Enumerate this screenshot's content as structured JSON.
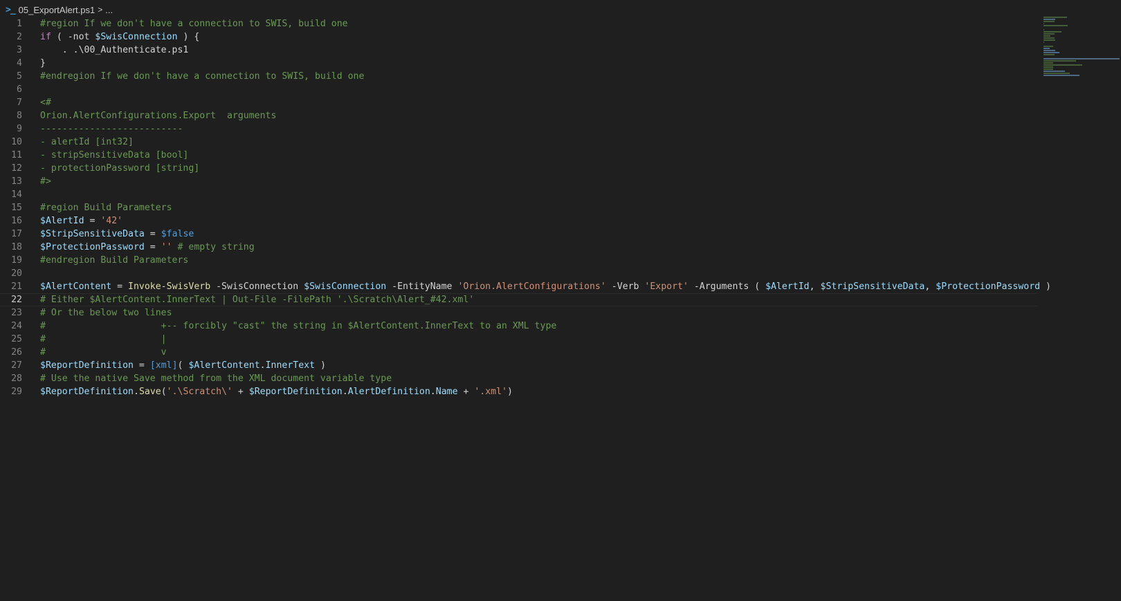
{
  "breadcrumb": {
    "icon": "powershell-icon",
    "file": "05_ExportAlert.ps1",
    "separator": ">",
    "more": "..."
  },
  "colors": {
    "background": "#1f1f1f",
    "comment": "#6a9955",
    "keyword": "#c586c0",
    "variable": "#9cdcfe",
    "string": "#ce9178",
    "function": "#dcdcaa",
    "boolean": "#569cd6",
    "plain": "#d4d4d4",
    "line_number": "#858585"
  },
  "editor": {
    "current_line": 22,
    "lines": [
      {
        "n": "1",
        "tokens": [
          [
            "com",
            "#region If we don't have a connection to SWIS, build one"
          ]
        ]
      },
      {
        "n": "2",
        "tokens": [
          [
            "kw",
            "if"
          ],
          [
            "plain",
            " ( -not "
          ],
          [
            "var",
            "$SwisConnection"
          ],
          [
            "plain",
            " ) {"
          ]
        ]
      },
      {
        "n": "3",
        "tokens": [
          [
            "plain",
            "    . .\\00_Authenticate.ps1"
          ]
        ]
      },
      {
        "n": "4",
        "tokens": [
          [
            "plain",
            "}"
          ]
        ]
      },
      {
        "n": "5",
        "tokens": [
          [
            "com",
            "#endregion If we don't have a connection to SWIS, build one"
          ]
        ]
      },
      {
        "n": "6",
        "tokens": []
      },
      {
        "n": "7",
        "tokens": [
          [
            "com",
            "<#"
          ]
        ]
      },
      {
        "n": "8",
        "tokens": [
          [
            "com",
            "Orion.AlertConfigurations.Export  arguments"
          ]
        ]
      },
      {
        "n": "9",
        "tokens": [
          [
            "com",
            "--------------------------"
          ]
        ]
      },
      {
        "n": "10",
        "tokens": [
          [
            "com",
            "- alertId [int32]"
          ]
        ]
      },
      {
        "n": "11",
        "tokens": [
          [
            "com",
            "- stripSensitiveData [bool]"
          ]
        ]
      },
      {
        "n": "12",
        "tokens": [
          [
            "com",
            "- protectionPassword [string]"
          ]
        ]
      },
      {
        "n": "13",
        "tokens": [
          [
            "com",
            "#>"
          ]
        ]
      },
      {
        "n": "14",
        "tokens": []
      },
      {
        "n": "15",
        "tokens": [
          [
            "com",
            "#region Build Parameters"
          ]
        ]
      },
      {
        "n": "16",
        "tokens": [
          [
            "var",
            "$AlertId"
          ],
          [
            "plain",
            " = "
          ],
          [
            "str",
            "'42'"
          ]
        ]
      },
      {
        "n": "17",
        "tokens": [
          [
            "var",
            "$StripSensitiveData"
          ],
          [
            "plain",
            " = "
          ],
          [
            "bool",
            "$false"
          ]
        ]
      },
      {
        "n": "18",
        "tokens": [
          [
            "var",
            "$ProtectionPassword"
          ],
          [
            "plain",
            " = "
          ],
          [
            "str",
            "''"
          ],
          [
            "com",
            " # empty string"
          ]
        ]
      },
      {
        "n": "19",
        "tokens": [
          [
            "com",
            "#endregion Build Parameters"
          ]
        ]
      },
      {
        "n": "20",
        "tokens": []
      },
      {
        "n": "21",
        "tokens": [
          [
            "var",
            "$AlertContent"
          ],
          [
            "plain",
            " = "
          ],
          [
            "fn",
            "Invoke-SwisVerb"
          ],
          [
            "plain",
            " -SwisConnection "
          ],
          [
            "var",
            "$SwisConnection"
          ],
          [
            "plain",
            " -EntityName "
          ],
          [
            "str",
            "'Orion.AlertConfigurations'"
          ],
          [
            "plain",
            " -Verb "
          ],
          [
            "str",
            "'Export'"
          ],
          [
            "plain",
            " -Arguments ( "
          ],
          [
            "var",
            "$AlertId"
          ],
          [
            "plain",
            ", "
          ],
          [
            "var",
            "$StripSensitiveData"
          ],
          [
            "plain",
            ", "
          ],
          [
            "var",
            "$ProtectionPassword"
          ],
          [
            "plain",
            " )"
          ]
        ]
      },
      {
        "n": "22",
        "tokens": [
          [
            "com",
            "# Either $AlertContent.InnerText | Out-File -FilePath '.\\Scratch\\Alert_#42.xml'"
          ]
        ]
      },
      {
        "n": "23",
        "tokens": [
          [
            "com",
            "# Or the below two lines"
          ]
        ]
      },
      {
        "n": "24",
        "tokens": [
          [
            "com",
            "#                     +-- forcibly \"cast\" the string in $AlertContent.InnerText to an XML type"
          ]
        ]
      },
      {
        "n": "25",
        "tokens": [
          [
            "com",
            "#                     |"
          ]
        ]
      },
      {
        "n": "26",
        "tokens": [
          [
            "com",
            "#                     v"
          ]
        ]
      },
      {
        "n": "27",
        "tokens": [
          [
            "var",
            "$ReportDefinition"
          ],
          [
            "plain",
            " = "
          ],
          [
            "bracket",
            "["
          ],
          [
            "xml",
            "xml"
          ],
          [
            "bracket",
            "]"
          ],
          [
            "plain",
            "( "
          ],
          [
            "var",
            "$AlertContent"
          ],
          [
            "plain",
            "."
          ],
          [
            "var",
            "InnerText"
          ],
          [
            "plain",
            " )"
          ]
        ]
      },
      {
        "n": "28",
        "tokens": [
          [
            "com",
            "# Use the native Save method from the XML document variable type"
          ]
        ]
      },
      {
        "n": "29",
        "tokens": [
          [
            "var",
            "$ReportDefinition"
          ],
          [
            "plain",
            "."
          ],
          [
            "fn",
            "Save"
          ],
          [
            "plain",
            "("
          ],
          [
            "str",
            "'.\\Scratch\\'"
          ],
          [
            "plain",
            " + "
          ],
          [
            "var",
            "$ReportDefinition"
          ],
          [
            "plain",
            "."
          ],
          [
            "var",
            "AlertDefinition"
          ],
          [
            "plain",
            "."
          ],
          [
            "var",
            "Name"
          ],
          [
            "plain",
            " + "
          ],
          [
            "str",
            "'.xml'"
          ],
          [
            "plain",
            ")"
          ]
        ]
      }
    ]
  }
}
